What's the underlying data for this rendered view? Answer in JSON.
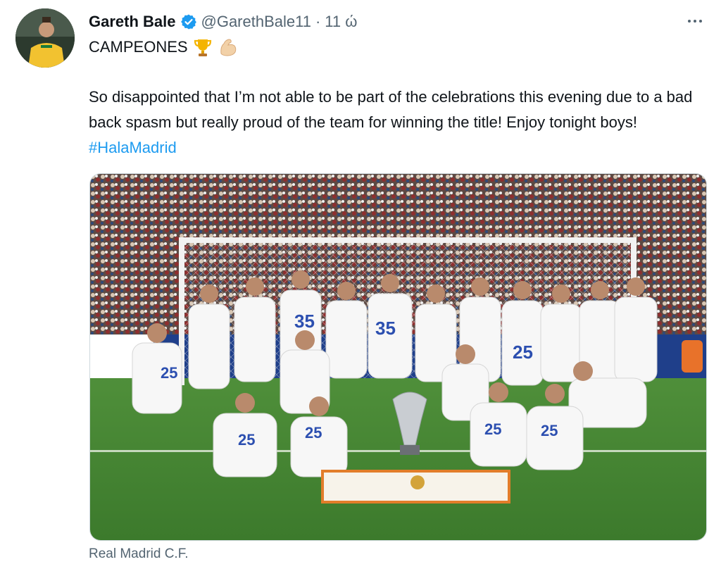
{
  "tweet": {
    "display_name": "Gareth Bale",
    "handle": "@GarethBale11",
    "separator": "·",
    "time": "11 ώ",
    "first_line": "CAMPEONES",
    "first_line_emojis": [
      "trophy-icon",
      "flexed-biceps-icon"
    ],
    "body_text": "So disappointed that I’m not able to be part of the celebrations this evening due to a bad back spasm but really proud of the team for winning the title! Enjoy tonight boys!",
    "hashtag": "#HalaMadrid",
    "media_caption": "Real Madrid C.F."
  },
  "colors": {
    "text": "#0f1419",
    "secondary_text": "#536471",
    "link": "#1d9bf0",
    "verified_badge": "#1d9bf0",
    "border": "#cfd9de"
  },
  "icons": {
    "verified": "verified-badge-icon",
    "more": "more-options-icon"
  }
}
